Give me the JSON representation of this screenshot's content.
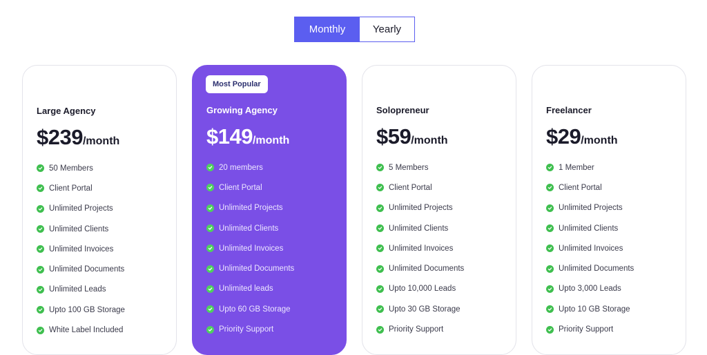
{
  "billing_toggle": {
    "monthly_label": "Monthly",
    "yearly_label": "Yearly",
    "selected": "Monthly"
  },
  "colors": {
    "accent": "#5b5ef0",
    "featured": "#7a4fe6",
    "check": "#3fbf4f"
  },
  "plans": [
    {
      "name": "Large Agency",
      "price": "$239",
      "period": "/month",
      "badge": "",
      "features": [
        "50 Members",
        "Client Portal",
        "Unlimited Projects",
        "Unlimited Clients",
        "Unlimited Invoices",
        "Unlimited Documents",
        "Unlimited Leads",
        "Upto 100 GB Storage",
        "White Label Included"
      ]
    },
    {
      "name": "Growing Agency",
      "price": "$149",
      "period": "/month",
      "badge": "Most Popular",
      "features": [
        "20 members",
        "Client Portal",
        "Unlimited Projects",
        "Unlimited Clients",
        "Unlimited Invoices",
        "Unlimited Documents",
        "Unlimited leads",
        "Upto 60 GB Storage",
        "Priority Support"
      ]
    },
    {
      "name": "Solopreneur",
      "price": "$59",
      "period": "/month",
      "badge": "",
      "features": [
        "5 Members",
        "Client Portal",
        "Unlimited Projects",
        "Unlimited Clients",
        "Unlimited Invoices",
        "Unlimited Documents",
        "Upto 10,000 Leads",
        "Upto 30 GB Storage",
        "Priority Support"
      ]
    },
    {
      "name": "Freelancer",
      "price": "$29",
      "period": "/month",
      "badge": "",
      "features": [
        "1 Member",
        "Client Portal",
        "Unlimited Projects",
        "Unlimited Clients",
        "Unlimited Invoices",
        "Unlimited Documents",
        "Upto 3,000 Leads",
        "Upto 10 GB Storage",
        "Priority Support"
      ]
    }
  ]
}
